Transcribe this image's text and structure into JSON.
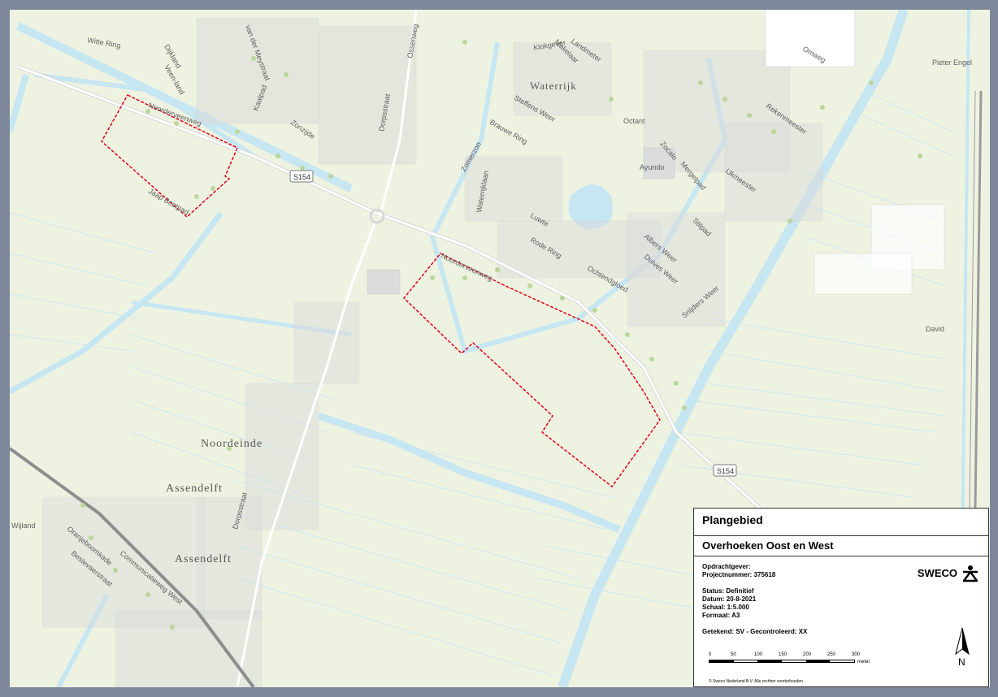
{
  "map": {
    "roads": {
      "road_shield_1": "S154",
      "road_shield_2": "S154"
    },
    "street_labels": [
      "Witte Ring",
      "Dijkland",
      "Veen-land",
      "van der Meystraat",
      "Kaalpad",
      "Zonzijde",
      "Noorderveenweg",
      "Jaap Bootpad",
      "Dorpsstraat",
      "Ossenweg",
      "Landmeter",
      "Makelaar",
      "Klokgever",
      "Steffens Weer",
      "Brauwe Ring",
      "Zomerzon",
      "Waterrijklaan",
      "Luwte",
      "Rode Ring",
      "Ochtendgloed",
      "Albers Weer",
      "Duives Weer",
      "Snijders Weer",
      "Stilpad",
      "Zocalo",
      "Mergelpad",
      "IJkmeester",
      "Rekenmeester",
      "Omweg",
      "Pieter Engel",
      "Noorderveenweg",
      "Oranjeboomkade",
      "Communicatieweg West",
      "Bestevaerstraat",
      "Dorpsstraat",
      "Wijland"
    ],
    "place_labels": {
      "waterrijk": "Waterrijk",
      "noordeinde": "Noordeinde",
      "assendelft_1": "Assendelft",
      "assendelft_2": "Assendelft"
    },
    "poi_labels": {
      "octant": "Octant",
      "ayundo": "Ayundo",
      "david": "David"
    },
    "colors": {
      "land": "#eef3e1",
      "water": "#c6e6f2",
      "buildings": "#dcdcdc",
      "plan_boundary": "#e3001b"
    }
  },
  "legend": {
    "title": "Plangebied",
    "subtitle": "Overhoeken Oost en West",
    "opdrachtgever": "Opdrachtgever:",
    "projectnummer": "Projectnummer: 375618",
    "status": "Status: Definitief",
    "datum": "Datum: 20-8-2021",
    "schaal": "Schaal: 1:5.000",
    "formaat": "Formaat: A3",
    "getekend": "Getekend: SV - Gecontroleerd: XX",
    "logo_text": "SWECO",
    "scale_labels": [
      "0",
      "50",
      "100",
      "150",
      "200",
      "250",
      "300"
    ],
    "scale_unit": "meter",
    "north_label": "N",
    "copyright": "© Sweco Nederland B.V.  Alle rechten voorbehouden"
  }
}
